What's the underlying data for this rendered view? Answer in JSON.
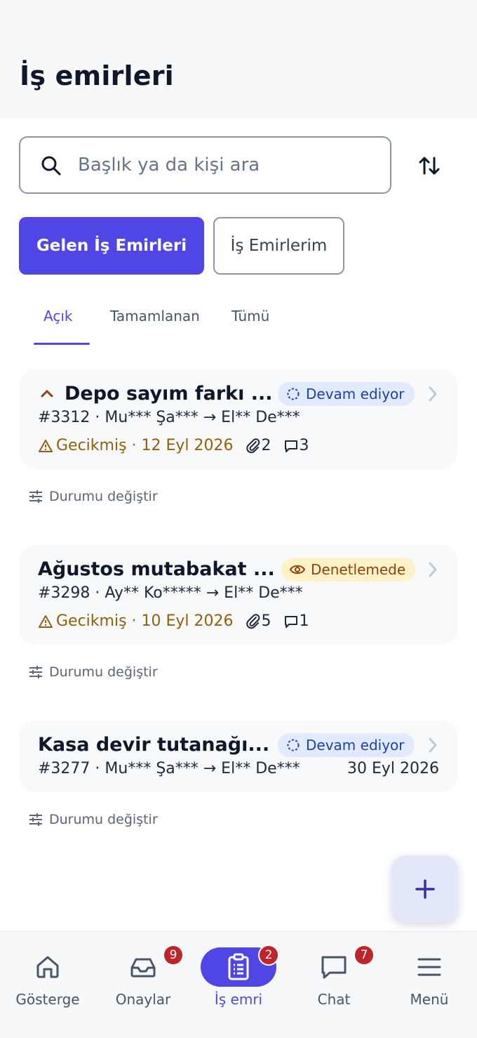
{
  "page": {
    "title": "İş emirleri"
  },
  "search": {
    "placeholder": "Başlık ya da kişi ara",
    "value": ""
  },
  "segments": {
    "primary": "Gelen İş Emirleri",
    "secondary": "İş Emirlerim"
  },
  "tabs": [
    {
      "label": "Açık",
      "active": true
    },
    {
      "label": "Tamamlanan",
      "active": false
    },
    {
      "label": "Tümü",
      "active": false
    }
  ],
  "orders": [
    {
      "title": "Depo sayım farkı ...",
      "status": "Devam ediyor",
      "meta": "#3312 · Mu*** Şa*** → El** De***",
      "overdue": "Gecikmiş · 12 Eyl 2026",
      "attachments": "2",
      "comments": "3",
      "status_action": "Durumu değiştir"
    },
    {
      "title": "Ağustos mutabakat ...",
      "status": "Denetlemede",
      "meta": "#3298 · Ay** Ko***** → El** De***",
      "overdue": "Gecikmiş · 10 Eyl 2026",
      "attachments": "5",
      "comments": "1",
      "status_action": "Durumu değiştir"
    },
    {
      "title": "Kasa devir tutanağı...",
      "status": "Devam ediyor",
      "meta": "#3277 · Mu*** Şa*** → El** De***",
      "date": "30 Eyl 2026",
      "status_action": "Durumu değiştir"
    }
  ],
  "fab": {
    "icon": "plus-icon"
  },
  "nav": [
    {
      "label": "Gösterge",
      "icon": "home-icon"
    },
    {
      "label": "Onaylar",
      "icon": "inbox-icon",
      "badge": "9"
    },
    {
      "label": "İş emri",
      "icon": "clipboard-icon",
      "badge": "2",
      "active": true
    },
    {
      "label": "Chat",
      "icon": "chat-icon",
      "badge": "7"
    },
    {
      "label": "Menü",
      "icon": "menu-icon"
    }
  ],
  "colors": {
    "accent": "#4f46e5",
    "badge_red": "#c0242b",
    "overdue": "#92600a"
  }
}
